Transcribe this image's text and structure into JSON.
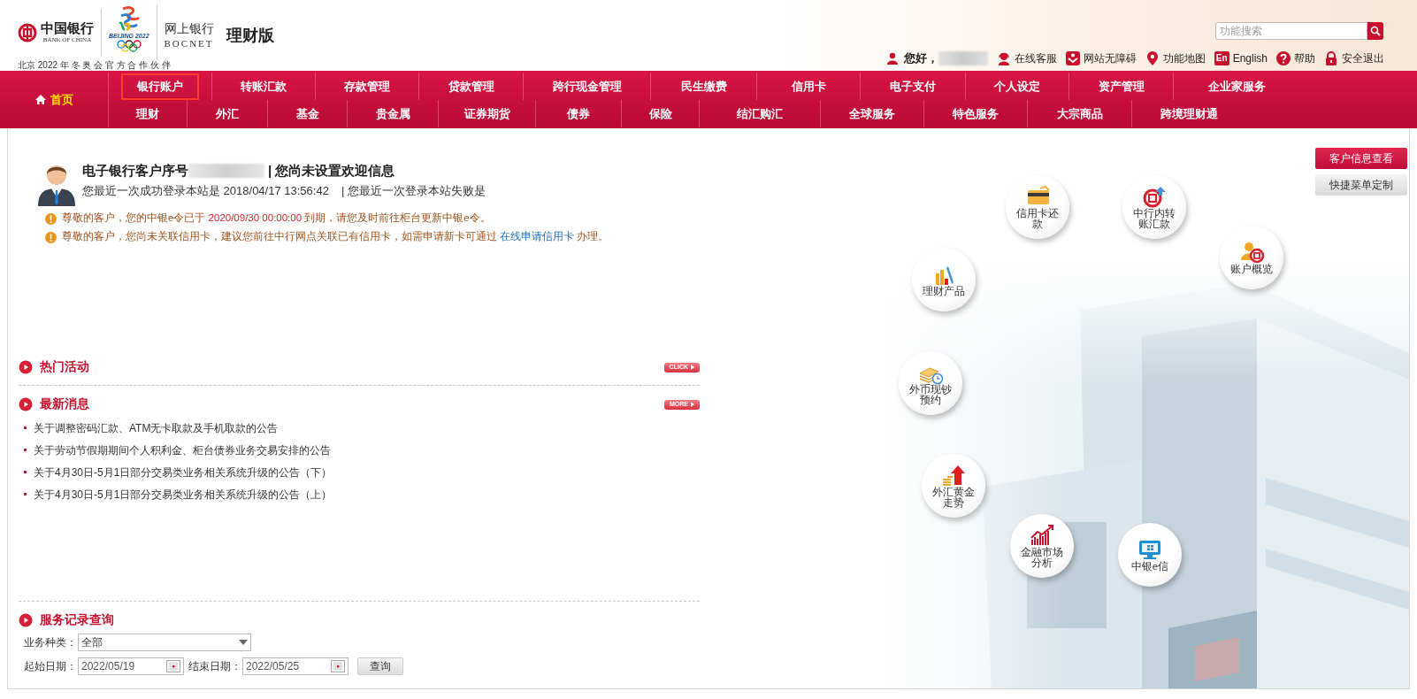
{
  "header": {
    "bank_name": "中国银行",
    "bank_name_en": "BANK OF CHINA",
    "emblem_text": "BEIJING 2022",
    "sponsor_line": "北京 2022 年 冬 奥 会 官 方 合 作 伙 伴",
    "product_name": "网上银行",
    "product_name_en": "BOCNET",
    "edition": "理财版"
  },
  "search": {
    "placeholder": "功能搜索"
  },
  "user_bar": {
    "greeting": "您好，",
    "links": [
      {
        "kind": "service",
        "label": "在线客服"
      },
      {
        "kind": "accessibility",
        "label": "网站无障碍"
      },
      {
        "kind": "map",
        "label": "功能地图"
      },
      {
        "kind": "language",
        "badge": "En",
        "label": "English"
      },
      {
        "kind": "help",
        "label": "帮助"
      },
      {
        "kind": "logout",
        "label": "安全退出"
      }
    ]
  },
  "nav": {
    "home": {
      "label": "首页",
      "selected": true
    },
    "row_1": [
      {
        "label": "银行账户",
        "selected": false,
        "outlined": true
      },
      {
        "label": "转账汇款",
        "selected": false,
        "outlined": false
      },
      {
        "label": "存款管理",
        "selected": false,
        "outlined": false
      },
      {
        "label": "贷款管理",
        "selected": false,
        "outlined": false
      },
      {
        "label": "跨行现金管理",
        "selected": false,
        "outlined": false
      },
      {
        "label": "民生缴费",
        "selected": false,
        "outlined": false
      },
      {
        "label": "信用卡",
        "selected": false,
        "outlined": false
      },
      {
        "label": "电子支付",
        "selected": false,
        "outlined": false
      },
      {
        "label": "个人设定",
        "selected": false,
        "outlined": false
      },
      {
        "label": "资产管理",
        "selected": false,
        "outlined": false
      },
      {
        "label": "企业家服务",
        "selected": false,
        "outlined": false
      }
    ],
    "row_2": [
      {
        "label": "理财",
        "selected": false
      },
      {
        "label": "外汇",
        "selected": false
      },
      {
        "label": "基金",
        "selected": false
      },
      {
        "label": "贵金属",
        "selected": false
      },
      {
        "label": "证券期货",
        "selected": false
      },
      {
        "label": "债券",
        "selected": false
      },
      {
        "label": "保险",
        "selected": false
      },
      {
        "label": "结汇购汇",
        "selected": false
      },
      {
        "label": "全球服务",
        "selected": false
      },
      {
        "label": "特色服务",
        "selected": false
      },
      {
        "label": "大宗商品",
        "selected": false
      },
      {
        "label": "跨境理财通",
        "selected": false
      }
    ]
  },
  "welcome": {
    "title": "电子银行客户序号",
    "title_suffix": "| 您尚未设置欢迎信息",
    "last_login": "您最近一次成功登录本站是 2018/04/17 13:56:42",
    "last_failed": "| 您最近一次登录本站失败是"
  },
  "notices": [
    {
      "parts": [
        {
          "kind": "plain",
          "text": "尊敬的客户，您的中银e令已于 "
        },
        {
          "kind": "alert",
          "text": "2020/09/30 00:00:00"
        },
        {
          "kind": "plain",
          "text": " 到期，请您及时前往柜台更新中银e令。"
        }
      ]
    },
    {
      "parts": [
        {
          "kind": "plain",
          "text": "尊敬的客户，您尚未关联信用卡，建议您前往中行网点关联已有信用卡，如需申请新卡可通过 "
        },
        {
          "kind": "link",
          "text": "在线申请信用卡"
        },
        {
          "kind": "plain",
          "text": " 办理。"
        }
      ]
    }
  ],
  "hot_activities": {
    "title": "热门活动",
    "button": "CLICK"
  },
  "news": {
    "title": "最新消息",
    "button": "MORE",
    "items": [
      "关于调整密码汇款、ATM无卡取款及手机取款的公告",
      "关于劳动节假期期间个人积利金、柜台债券业务交易安排的公告",
      "关于4月30日-5月1日部分交易类业务相关系统升级的公告（下）",
      "关于4月30日-5月1日部分交易类业务相关系统升级的公告（上）"
    ]
  },
  "service_records": {
    "title": "服务记录查询",
    "type_label": "业务种类：",
    "type_value": "全部",
    "start_label": "起始日期：",
    "start_value": "2022/05/19",
    "end_label": "结束日期：",
    "end_value": "2022/05/25",
    "button": "查询"
  },
  "side_buttons": [
    {
      "kind": "primary",
      "label": "客户信息查看"
    },
    {
      "kind": "secondary",
      "label": "快捷菜单定制"
    }
  ],
  "shortcuts": [
    {
      "kind": "card",
      "label": "信用卡还款"
    },
    {
      "kind": "transfer",
      "label": "中行内转账汇款"
    },
    {
      "kind": "account",
      "label": "账户概览"
    },
    {
      "kind": "chart",
      "label": "理财产品"
    },
    {
      "kind": "cash",
      "label": "外币现钞预约"
    },
    {
      "kind": "gold",
      "label": "外汇黄金走势"
    },
    {
      "kind": "market",
      "label": "金融市场分析"
    },
    {
      "kind": "computer",
      "label": "中银e信"
    }
  ]
}
